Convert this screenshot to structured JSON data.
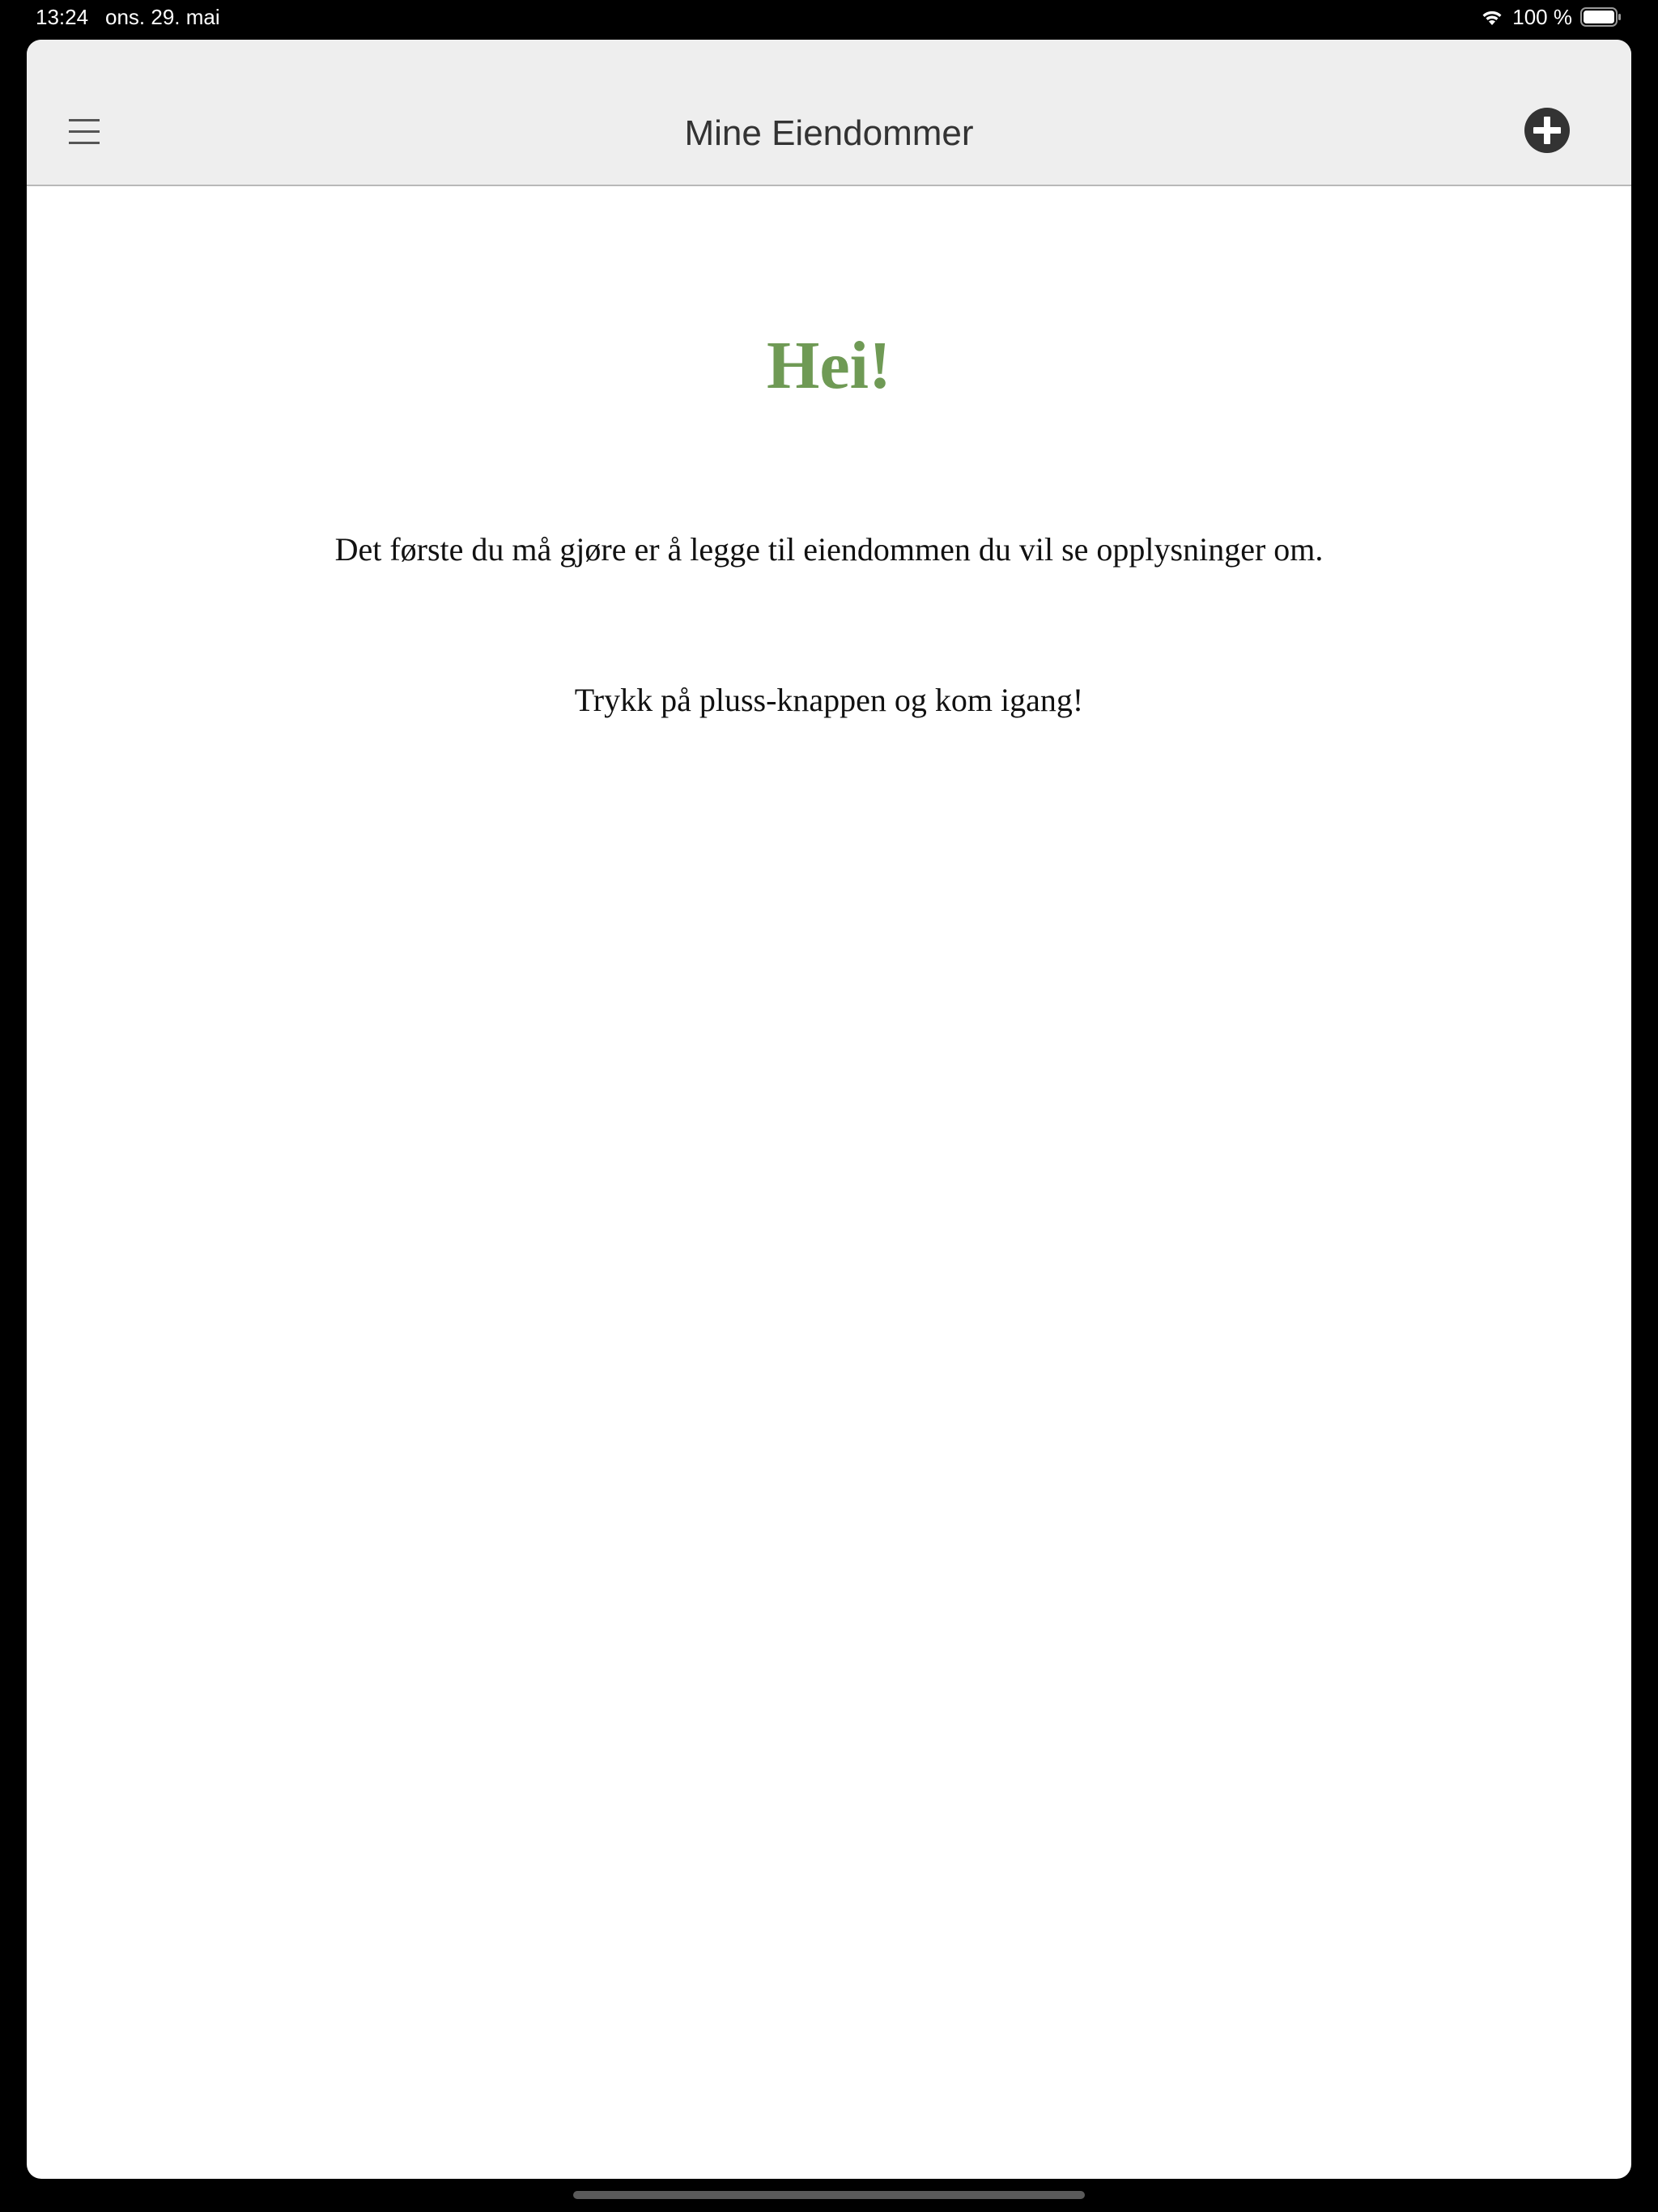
{
  "status_bar": {
    "time": "13:24",
    "date": "ons. 29. mai",
    "battery": "100 %",
    "wifi_icon": "wifi-icon",
    "battery_icon": "battery-icon"
  },
  "navbar": {
    "title": "Mine Eiendommer",
    "menu_icon": "hamburger-menu-icon",
    "add_icon": "plus-circle-icon"
  },
  "main": {
    "greeting": "Hei!",
    "intro": "Det første du må gjøre er å legge til eiendommen du vil se opplysninger om.",
    "call_to_action": "Trykk på pluss-knappen og kom igang!"
  },
  "colors": {
    "greeting": "#6f9a55",
    "navbar_background": "#eeeeee",
    "icon_dark": "#333333"
  }
}
